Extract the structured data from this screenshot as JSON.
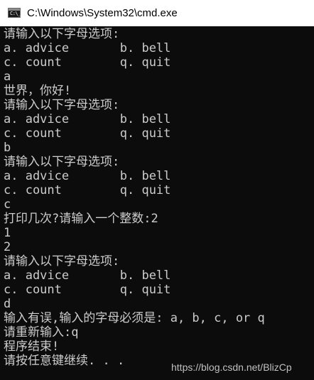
{
  "window": {
    "title": "C:\\Windows\\System32\\cmd.exe",
    "icon": "cmd-icon",
    "icon_glyph": "C:\\_",
    "background": "#0c0c0c",
    "foreground": "#cccccc"
  },
  "console": {
    "lines": [
      "请输入以下字母选项:",
      "a. advice       b. bell",
      "c. count        q. quit",
      "a",
      "世界，你好!",
      "请输入以下字母选项:",
      "a. advice       b. bell",
      "c. count        q. quit",
      "b",
      "请输入以下字母选项:",
      "a. advice       b. bell",
      "c. count        q. quit",
      "c",
      "打印几次?请输入一个整数:2",
      "1",
      "2",
      "请输入以下字母选项:",
      "a. advice       b. bell",
      "c. count        q. quit",
      "d",
      "输入有误,输入的字母必须是: a, b, c, or q",
      "请重新输入:q",
      "程序结束!",
      "请按任意键继续. . ."
    ]
  },
  "watermark": "https://blog.csdn.net/BlizCp"
}
